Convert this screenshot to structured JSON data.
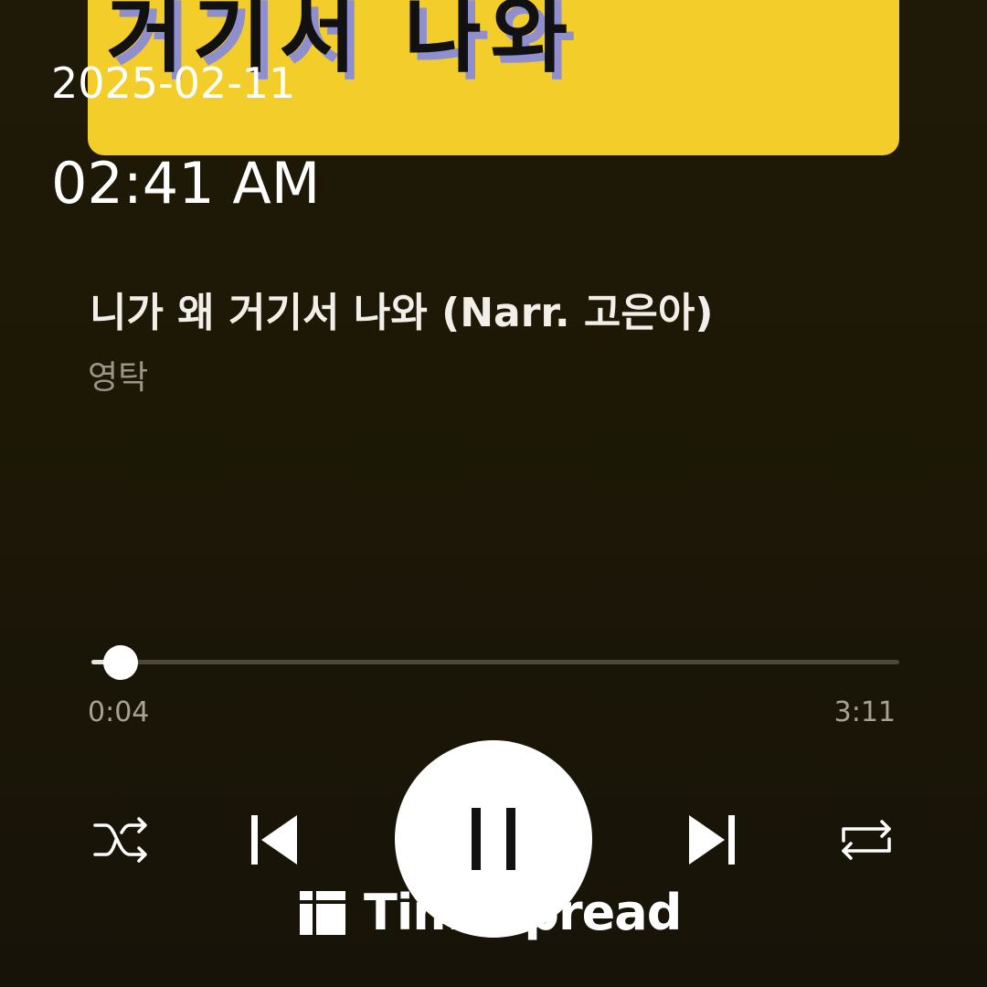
{
  "album_art": {
    "partial_text": "거기서 나와",
    "background": "#f3cd2a"
  },
  "overlay": {
    "date": "2025-02-11",
    "time": "02:41 AM"
  },
  "track": {
    "title": "니가 왜 거기서 나와 (Narr. 고은아)",
    "artist": "영탁"
  },
  "progress": {
    "elapsed": "0:04",
    "total": "3:11",
    "fraction": 0.021
  },
  "controls": {
    "shuffle_icon": "shuffle-icon",
    "previous_icon": "skip-previous-icon",
    "play_pause_icon": "pause-icon",
    "next_icon": "skip-next-icon",
    "repeat_icon": "repeat-icon"
  },
  "watermark": {
    "text": "Timespread"
  },
  "colors": {
    "accent": "#ffffff",
    "background": "#1c170a",
    "secondary_text": "#9b968c"
  }
}
